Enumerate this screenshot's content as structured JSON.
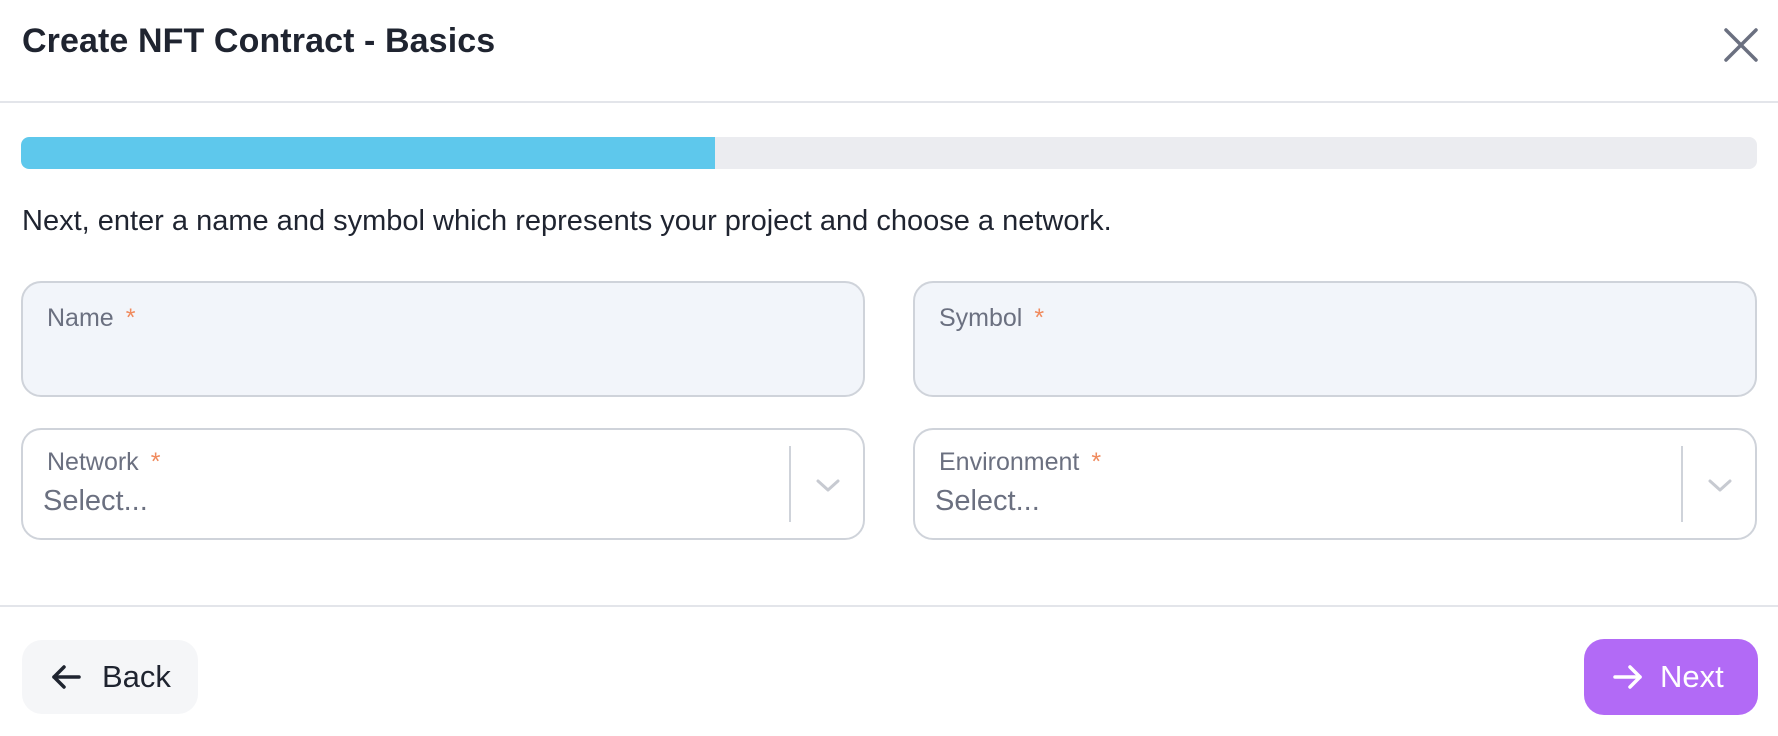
{
  "modal": {
    "title": "Create NFT Contract - Basics",
    "progress_percent": 40
  },
  "intro_text": "Next, enter a name and symbol which represents your project and choose a network.",
  "form": {
    "name": {
      "label": "Name",
      "required_mark": "*",
      "value": ""
    },
    "symbol": {
      "label": "Symbol",
      "required_mark": "*",
      "value": ""
    },
    "network": {
      "label": "Network",
      "required_mark": "*",
      "placeholder": "Select..."
    },
    "environment": {
      "label": "Environment",
      "required_mark": "*",
      "placeholder": "Select..."
    }
  },
  "footer": {
    "back_label": "Back",
    "next_label": "Next"
  },
  "icons": {
    "close": "close-icon",
    "chevron": "chevron-down-icon",
    "back": "arrow-left-icon",
    "next": "arrow-right-icon"
  },
  "colors": {
    "progress_fill": "#5ec8ec",
    "progress_track": "#ebecf0",
    "next_button": "#b26af6",
    "required_mark": "#f08a5d",
    "input_background": "#f2f5fa"
  }
}
